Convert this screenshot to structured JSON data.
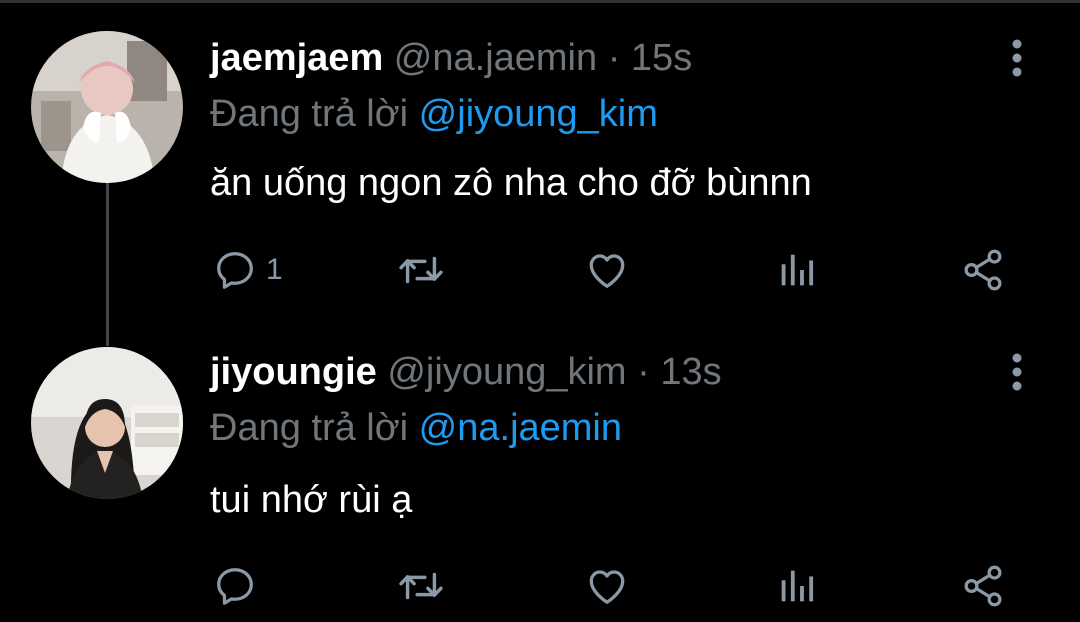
{
  "tweets": [
    {
      "display_name": "jaemjaem",
      "handle": "@na.jaemin",
      "separator": "·",
      "time": "15s",
      "reply_prefix": "Đang trả lời",
      "reply_handle": "@jiyoung_kim",
      "text": "ăn uống ngon zô nha cho đỡ bùnnn",
      "reply_count": "1",
      "avatar": "avatar-user-photo"
    },
    {
      "display_name": "jiyoungie",
      "handle": "@jiyoung_kim",
      "separator": "·",
      "time": "13s",
      "reply_prefix": "Đang trả lời",
      "reply_handle": "@na.jaemin",
      "text": "tui nhớ rùi ạ",
      "reply_count": "",
      "avatar": "avatar-user-photo"
    }
  ],
  "icons": {
    "reply": "reply-icon",
    "retweet": "retweet-icon",
    "like": "heart-icon",
    "stats": "stats-icon",
    "share": "share-icon",
    "more": "more-vertical-icon"
  },
  "colors": {
    "background": "#000000",
    "text_primary": "#ffffff",
    "text_secondary": "#71767b",
    "link": "#1d9bf0",
    "icon": "#8b98a5",
    "thread_line": "#42464a"
  }
}
